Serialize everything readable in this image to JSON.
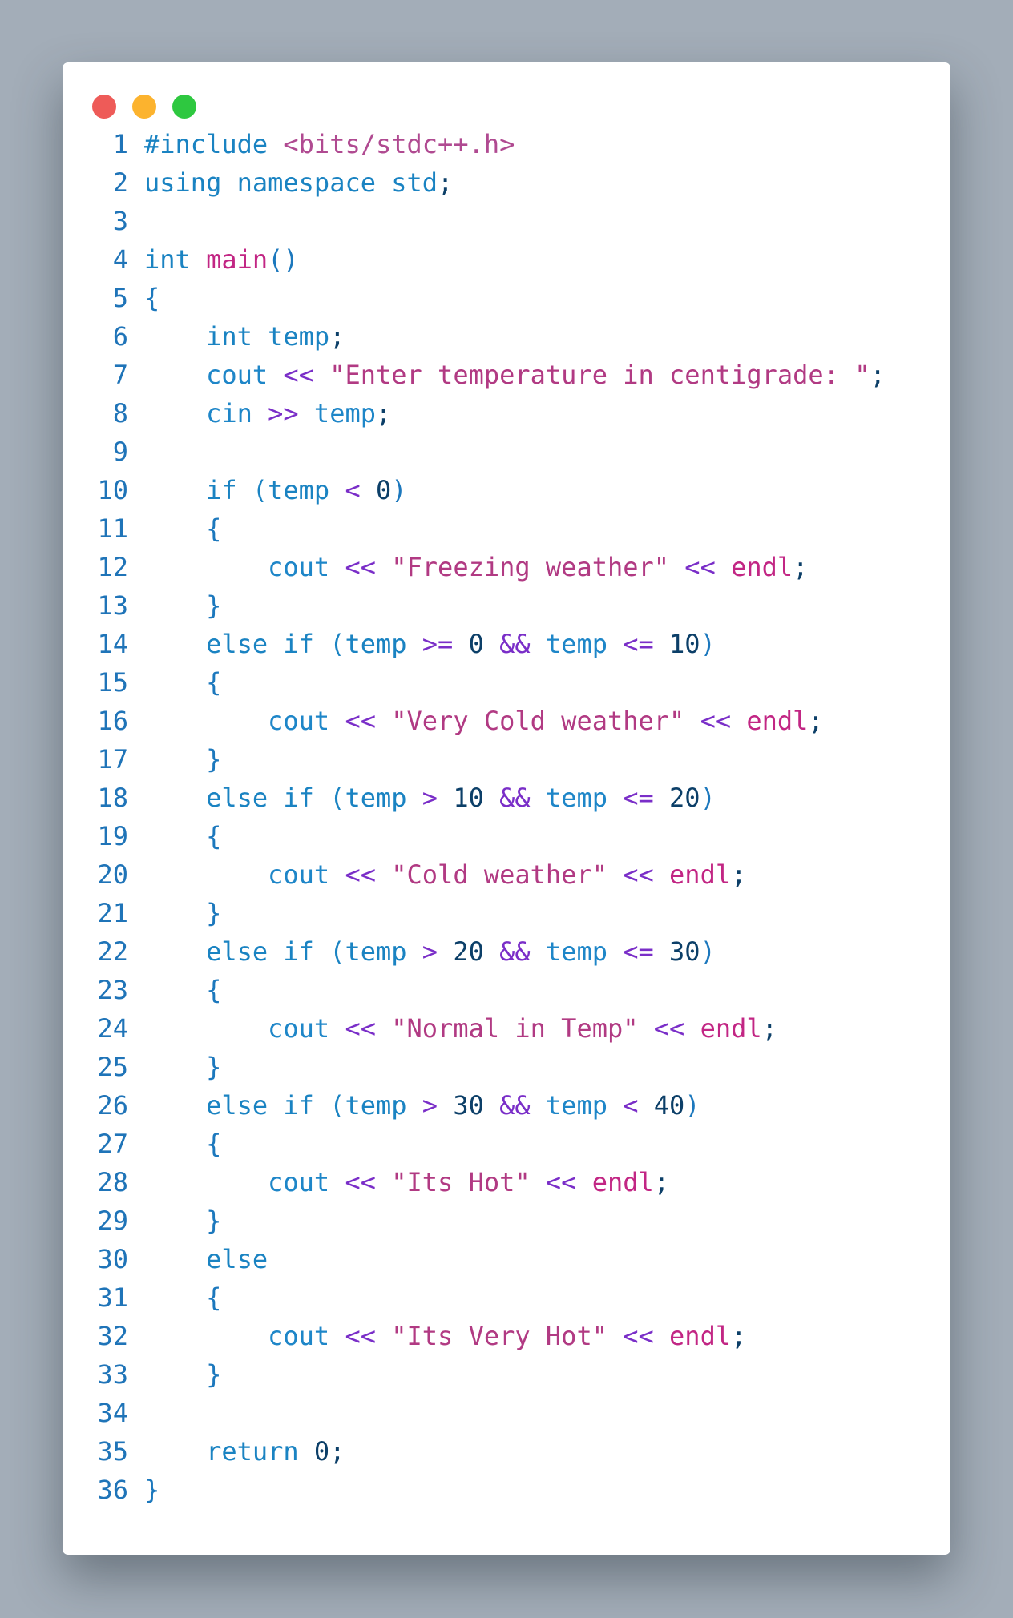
{
  "window": {
    "buttons": [
      {
        "name": "close",
        "color": "#ee5b58"
      },
      {
        "name": "minimize",
        "color": "#fcb32e"
      },
      {
        "name": "zoom",
        "color": "#2ec840"
      }
    ]
  },
  "colors": {
    "background": "#a3adb8",
    "window": "#ffffff",
    "keyword": "#1a83c2",
    "function": "#c22684",
    "string": "#b13a83",
    "operator": "#7a2ec8",
    "number": "#0c3f68",
    "line_number": "#1f74b8"
  },
  "code_lines": [
    {
      "n": "1",
      "tokens": [
        {
          "t": "#include ",
          "k": "kw"
        },
        {
          "t": "<bits/stdc++.h>",
          "k": "inc"
        }
      ]
    },
    {
      "n": "2",
      "tokens": [
        {
          "t": "using namespace std",
          "k": "kw"
        },
        {
          "t": ";",
          "k": "semi"
        }
      ]
    },
    {
      "n": "3",
      "tokens": []
    },
    {
      "n": "4",
      "tokens": [
        {
          "t": "int ",
          "k": "kw"
        },
        {
          "t": "main",
          "k": "fn"
        },
        {
          "t": "()",
          "k": "pu"
        }
      ]
    },
    {
      "n": "5",
      "tokens": [
        {
          "t": "{",
          "k": "pu"
        }
      ]
    },
    {
      "n": "6",
      "tokens": [
        {
          "t": "    int temp",
          "k": "kw"
        },
        {
          "t": ";",
          "k": "semi"
        }
      ]
    },
    {
      "n": "7",
      "tokens": [
        {
          "t": "    cout ",
          "k": "id"
        },
        {
          "t": "<<",
          "k": "op"
        },
        {
          "t": " ",
          "k": "pu"
        },
        {
          "t": "\"Enter temperature in centigrade: \"",
          "k": "str"
        },
        {
          "t": ";",
          "k": "semi"
        }
      ]
    },
    {
      "n": "8",
      "tokens": [
        {
          "t": "    cin ",
          "k": "id"
        },
        {
          "t": ">>",
          "k": "op"
        },
        {
          "t": " temp",
          "k": "id"
        },
        {
          "t": ";",
          "k": "semi"
        }
      ]
    },
    {
      "n": "9",
      "tokens": []
    },
    {
      "n": "10",
      "tokens": [
        {
          "t": "    if (temp ",
          "k": "kw"
        },
        {
          "t": "<",
          "k": "op"
        },
        {
          "t": " ",
          "k": "pu"
        },
        {
          "t": "0",
          "k": "num"
        },
        {
          "t": ")",
          "k": "pu"
        }
      ]
    },
    {
      "n": "11",
      "tokens": [
        {
          "t": "    {",
          "k": "pu"
        }
      ]
    },
    {
      "n": "12",
      "tokens": [
        {
          "t": "        cout ",
          "k": "id"
        },
        {
          "t": "<<",
          "k": "op"
        },
        {
          "t": " ",
          "k": "pu"
        },
        {
          "t": "\"Freezing weather\"",
          "k": "str"
        },
        {
          "t": " ",
          "k": "pu"
        },
        {
          "t": "<<",
          "k": "op"
        },
        {
          "t": " ",
          "k": "pu"
        },
        {
          "t": "endl",
          "k": "fn"
        },
        {
          "t": ";",
          "k": "semi"
        }
      ]
    },
    {
      "n": "13",
      "tokens": [
        {
          "t": "    }",
          "k": "pu"
        }
      ]
    },
    {
      "n": "14",
      "tokens": [
        {
          "t": "    else if (temp ",
          "k": "kw"
        },
        {
          "t": ">=",
          "k": "op"
        },
        {
          "t": " ",
          "k": "pu"
        },
        {
          "t": "0",
          "k": "num"
        },
        {
          "t": " ",
          "k": "pu"
        },
        {
          "t": "&&",
          "k": "op"
        },
        {
          "t": " temp ",
          "k": "id"
        },
        {
          "t": "<=",
          "k": "op"
        },
        {
          "t": " ",
          "k": "pu"
        },
        {
          "t": "10",
          "k": "num"
        },
        {
          "t": ")",
          "k": "pu"
        }
      ]
    },
    {
      "n": "15",
      "tokens": [
        {
          "t": "    {",
          "k": "pu"
        }
      ]
    },
    {
      "n": "16",
      "tokens": [
        {
          "t": "        cout ",
          "k": "id"
        },
        {
          "t": "<<",
          "k": "op"
        },
        {
          "t": " ",
          "k": "pu"
        },
        {
          "t": "\"Very Cold weather\"",
          "k": "str"
        },
        {
          "t": " ",
          "k": "pu"
        },
        {
          "t": "<<",
          "k": "op"
        },
        {
          "t": " ",
          "k": "pu"
        },
        {
          "t": "endl",
          "k": "fn"
        },
        {
          "t": ";",
          "k": "semi"
        }
      ]
    },
    {
      "n": "17",
      "tokens": [
        {
          "t": "    }",
          "k": "pu"
        }
      ]
    },
    {
      "n": "18",
      "tokens": [
        {
          "t": "    else if (temp ",
          "k": "kw"
        },
        {
          "t": ">",
          "k": "op"
        },
        {
          "t": " ",
          "k": "pu"
        },
        {
          "t": "10",
          "k": "num"
        },
        {
          "t": " ",
          "k": "pu"
        },
        {
          "t": "&&",
          "k": "op"
        },
        {
          "t": " temp ",
          "k": "id"
        },
        {
          "t": "<=",
          "k": "op"
        },
        {
          "t": " ",
          "k": "pu"
        },
        {
          "t": "20",
          "k": "num"
        },
        {
          "t": ")",
          "k": "pu"
        }
      ]
    },
    {
      "n": "19",
      "tokens": [
        {
          "t": "    {",
          "k": "pu"
        }
      ]
    },
    {
      "n": "20",
      "tokens": [
        {
          "t": "        cout ",
          "k": "id"
        },
        {
          "t": "<<",
          "k": "op"
        },
        {
          "t": " ",
          "k": "pu"
        },
        {
          "t": "\"Cold weather\"",
          "k": "str"
        },
        {
          "t": " ",
          "k": "pu"
        },
        {
          "t": "<<",
          "k": "op"
        },
        {
          "t": " ",
          "k": "pu"
        },
        {
          "t": "endl",
          "k": "fn"
        },
        {
          "t": ";",
          "k": "semi"
        }
      ]
    },
    {
      "n": "21",
      "tokens": [
        {
          "t": "    }",
          "k": "pu"
        }
      ]
    },
    {
      "n": "22",
      "tokens": [
        {
          "t": "    else if (temp ",
          "k": "kw"
        },
        {
          "t": ">",
          "k": "op"
        },
        {
          "t": " ",
          "k": "pu"
        },
        {
          "t": "20",
          "k": "num"
        },
        {
          "t": " ",
          "k": "pu"
        },
        {
          "t": "&&",
          "k": "op"
        },
        {
          "t": " temp ",
          "k": "id"
        },
        {
          "t": "<=",
          "k": "op"
        },
        {
          "t": " ",
          "k": "pu"
        },
        {
          "t": "30",
          "k": "num"
        },
        {
          "t": ")",
          "k": "pu"
        }
      ]
    },
    {
      "n": "23",
      "tokens": [
        {
          "t": "    {",
          "k": "pu"
        }
      ]
    },
    {
      "n": "24",
      "tokens": [
        {
          "t": "        cout ",
          "k": "id"
        },
        {
          "t": "<<",
          "k": "op"
        },
        {
          "t": " ",
          "k": "pu"
        },
        {
          "t": "\"Normal in Temp\"",
          "k": "str"
        },
        {
          "t": " ",
          "k": "pu"
        },
        {
          "t": "<<",
          "k": "op"
        },
        {
          "t": " ",
          "k": "pu"
        },
        {
          "t": "endl",
          "k": "fn"
        },
        {
          "t": ";",
          "k": "semi"
        }
      ]
    },
    {
      "n": "25",
      "tokens": [
        {
          "t": "    }",
          "k": "pu"
        }
      ]
    },
    {
      "n": "26",
      "tokens": [
        {
          "t": "    else if (temp ",
          "k": "kw"
        },
        {
          "t": ">",
          "k": "op"
        },
        {
          "t": " ",
          "k": "pu"
        },
        {
          "t": "30",
          "k": "num"
        },
        {
          "t": " ",
          "k": "pu"
        },
        {
          "t": "&&",
          "k": "op"
        },
        {
          "t": " temp ",
          "k": "id"
        },
        {
          "t": "<",
          "k": "op"
        },
        {
          "t": " ",
          "k": "pu"
        },
        {
          "t": "40",
          "k": "num"
        },
        {
          "t": ")",
          "k": "pu"
        }
      ]
    },
    {
      "n": "27",
      "tokens": [
        {
          "t": "    {",
          "k": "pu"
        }
      ]
    },
    {
      "n": "28",
      "tokens": [
        {
          "t": "        cout ",
          "k": "id"
        },
        {
          "t": "<<",
          "k": "op"
        },
        {
          "t": " ",
          "k": "pu"
        },
        {
          "t": "\"Its Hot\"",
          "k": "str"
        },
        {
          "t": " ",
          "k": "pu"
        },
        {
          "t": "<<",
          "k": "op"
        },
        {
          "t": " ",
          "k": "pu"
        },
        {
          "t": "endl",
          "k": "fn"
        },
        {
          "t": ";",
          "k": "semi"
        }
      ]
    },
    {
      "n": "29",
      "tokens": [
        {
          "t": "    }",
          "k": "pu"
        }
      ]
    },
    {
      "n": "30",
      "tokens": [
        {
          "t": "    else",
          "k": "kw"
        }
      ]
    },
    {
      "n": "31",
      "tokens": [
        {
          "t": "    {",
          "k": "pu"
        }
      ]
    },
    {
      "n": "32",
      "tokens": [
        {
          "t": "        cout ",
          "k": "id"
        },
        {
          "t": "<<",
          "k": "op"
        },
        {
          "t": " ",
          "k": "pu"
        },
        {
          "t": "\"Its Very Hot\"",
          "k": "str"
        },
        {
          "t": " ",
          "k": "pu"
        },
        {
          "t": "<<",
          "k": "op"
        },
        {
          "t": " ",
          "k": "pu"
        },
        {
          "t": "endl",
          "k": "fn"
        },
        {
          "t": ";",
          "k": "semi"
        }
      ]
    },
    {
      "n": "33",
      "tokens": [
        {
          "t": "    }",
          "k": "pu"
        }
      ]
    },
    {
      "n": "34",
      "tokens": []
    },
    {
      "n": "35",
      "tokens": [
        {
          "t": "    return ",
          "k": "kw"
        },
        {
          "t": "0",
          "k": "num"
        },
        {
          "t": ";",
          "k": "semi"
        }
      ]
    },
    {
      "n": "36",
      "tokens": [
        {
          "t": "}",
          "k": "pu"
        }
      ]
    }
  ]
}
